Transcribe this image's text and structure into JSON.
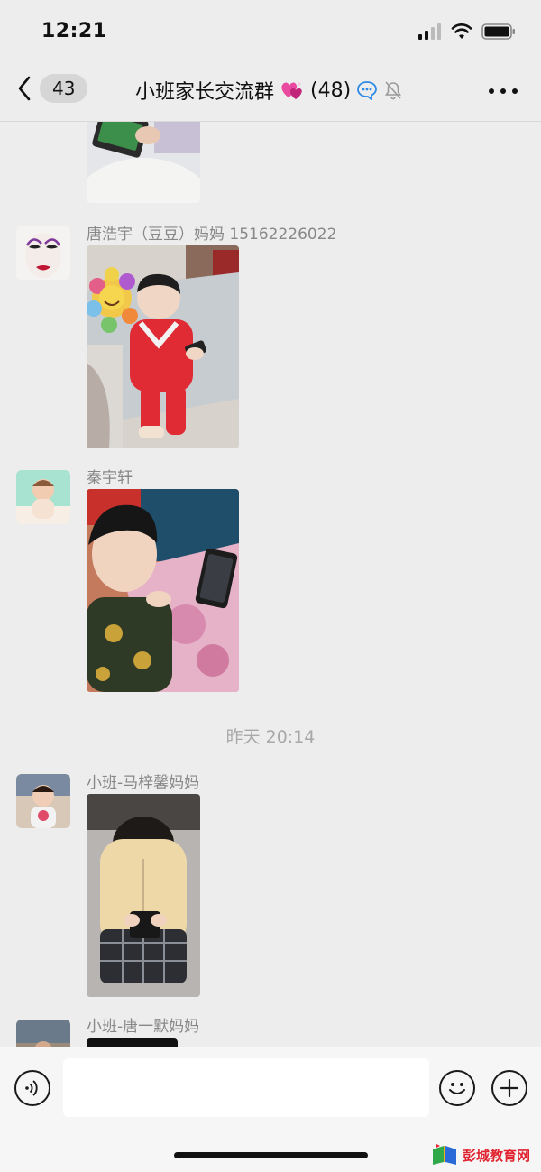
{
  "status_bar": {
    "time": "12:21"
  },
  "nav": {
    "back_count": "43",
    "title": "小班家长交流群",
    "member_count": "(48)"
  },
  "messages": [
    {
      "sender": "",
      "photo": "child-holding-phone"
    },
    {
      "sender": "唐浩宇（豆豆）妈妈 15162226022",
      "photo": "boy-in-red-on-bed-with-phone"
    },
    {
      "sender": "秦宇轩",
      "photo": "boy-on-floral-bed-with-phone"
    },
    {
      "sender": "小班-马梓馨妈妈",
      "photo": "girl-in-yellow-coat-with-phone"
    },
    {
      "sender": "小班-唐一默妈妈",
      "photo": ""
    }
  ],
  "timestamp": "昨天 20:14",
  "input_bar": {
    "placeholder": ""
  },
  "watermark": {
    "text": "彭城教育网"
  },
  "colors": {
    "background": "#ededed",
    "sender_text": "#888888",
    "input_bar": "#f6f6f6"
  },
  "icons": [
    "signal-icon",
    "wifi-icon",
    "battery-icon",
    "chevron-left-icon",
    "heart-emoji-icon",
    "chat-bubble-icon",
    "mute-bell-icon",
    "more-icon",
    "voice-icon",
    "emoji-icon",
    "plus-icon"
  ]
}
